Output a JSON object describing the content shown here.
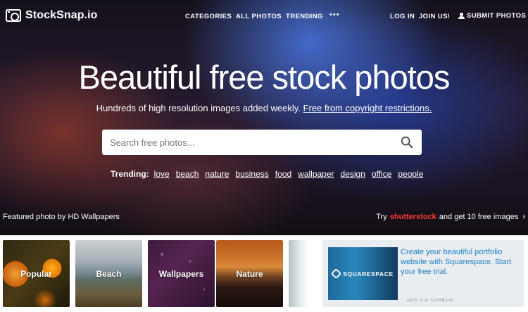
{
  "nav": {
    "logo_text": "StockSnap.io",
    "links": [
      "CATEGORIES",
      "ALL PHOTOS",
      "TRENDING"
    ],
    "more": "•••",
    "login": "LOG IN",
    "join": "JOIN US!",
    "submit": "SUBMIT PHOTOS"
  },
  "hero": {
    "headline": "Beautiful free stock photos",
    "sub_prefix": "Hundreds of high resolution images added weekly.",
    "sub_link": "Free from copyright restrictions."
  },
  "search": {
    "placeholder": "Search free photos..."
  },
  "trending": {
    "label": "Trending:",
    "tags": [
      "love",
      "beach",
      "nature",
      "business",
      "food",
      "wallpaper",
      "design",
      "office",
      "people"
    ]
  },
  "featured": {
    "prefix": "Featured photo by",
    "author": "HD Wallpapers"
  },
  "promo": {
    "prefix": "Try",
    "brand": "shutterstock",
    "suffix": "and get 10 free images",
    "chevron": "›"
  },
  "categories": [
    "Popular",
    "Beach",
    "Wallpapers",
    "Nature"
  ],
  "ad": {
    "brand": "SQUARESPACE",
    "copy": "Create your beautiful portfolio website with Squarespace. Start your free trial.",
    "via": "ADS VIA CARBON"
  }
}
